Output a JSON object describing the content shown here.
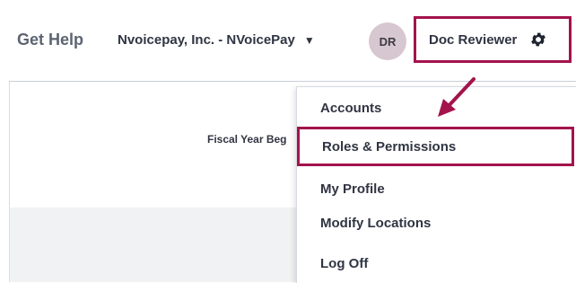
{
  "topbar": {
    "help_label": "Get Help",
    "company_label": "Nvoicepay, Inc. - NVoicePay",
    "company_caret": "▼",
    "avatar_initials": "DR",
    "user_name": "Doc Reviewer",
    "gear_icon": "gear-icon"
  },
  "content": {
    "fiscal_label": "Fiscal Year Beg"
  },
  "menu": {
    "items": [
      {
        "label": "Accounts"
      },
      {
        "label": "Roles & Permissions"
      },
      {
        "label": "My Profile"
      },
      {
        "label": "Modify Locations"
      },
      {
        "label": "Log Off"
      }
    ]
  },
  "colors": {
    "highlight": "#a3134c",
    "avatar_bg": "#d7c7d0",
    "text": "#2f3542"
  }
}
